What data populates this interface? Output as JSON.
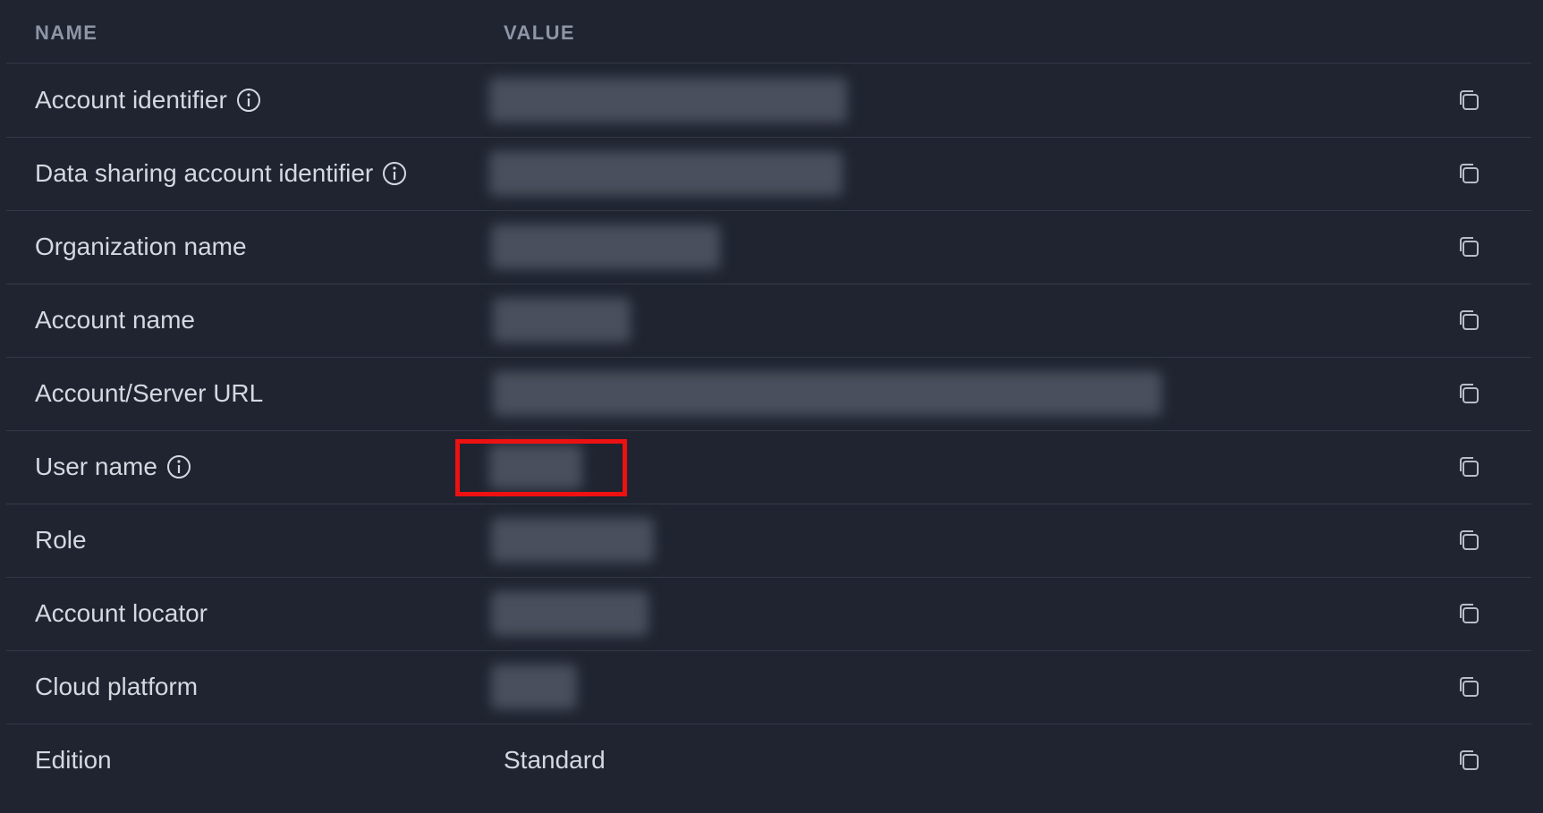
{
  "header": {
    "name_label": "NAME",
    "value_label": "VALUE"
  },
  "rows": [
    {
      "name": "Account identifier",
      "has_info": true,
      "value": null,
      "value_redacted": true
    },
    {
      "name": "Data sharing account identifier",
      "has_info": true,
      "value": null,
      "value_redacted": true
    },
    {
      "name": "Organization name",
      "has_info": false,
      "value": null,
      "value_redacted": true
    },
    {
      "name": "Account name",
      "has_info": false,
      "value": null,
      "value_redacted": true
    },
    {
      "name": "Account/Server URL",
      "has_info": false,
      "value": null,
      "value_redacted": true
    },
    {
      "name": "User name",
      "has_info": true,
      "value": null,
      "value_redacted": true,
      "highlighted": true
    },
    {
      "name": "Role",
      "has_info": false,
      "value": null,
      "value_redacted": true
    },
    {
      "name": "Account locator",
      "has_info": false,
      "value": null,
      "value_redacted": true
    },
    {
      "name": "Cloud platform",
      "has_info": false,
      "value": null,
      "value_redacted": true
    },
    {
      "name": "Edition",
      "has_info": false,
      "value": "Standard",
      "value_redacted": false
    }
  ],
  "icons": {
    "info": "info-circle-icon",
    "copy": "copy-icon"
  },
  "colors": {
    "background": "#1f2430",
    "text": "#d4d8e0",
    "header_text": "#8d96a6",
    "divider": "#333a47",
    "highlight": "#ee1111"
  }
}
